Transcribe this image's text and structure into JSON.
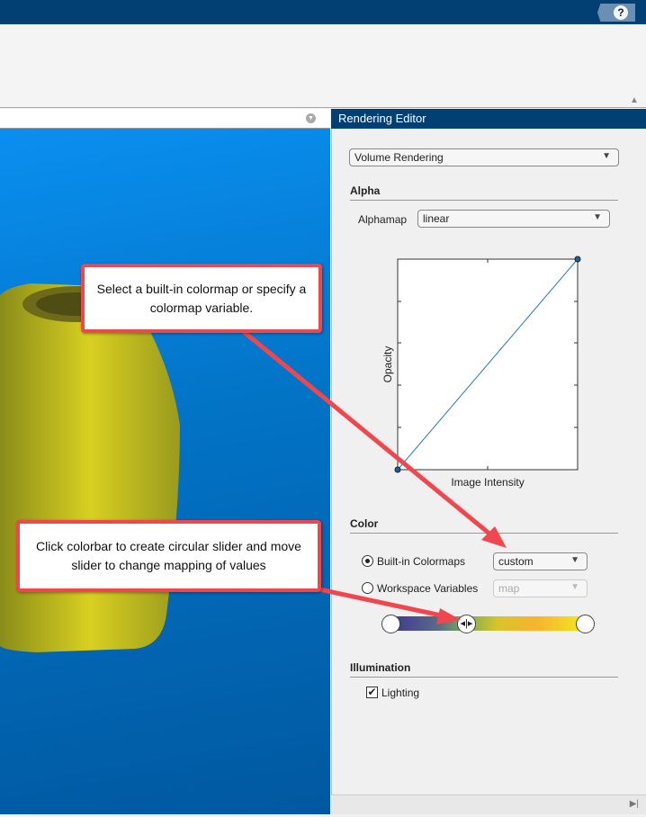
{
  "help_label": "?",
  "panel": {
    "title": "Rendering Editor",
    "render_mode": "Volume Rendering",
    "alpha": {
      "section": "Alpha",
      "alphamap_label": "Alphamap",
      "alphamap_value": "linear",
      "plot": {
        "xlabel": "Image Intensity",
        "ylabel": "Opacity",
        "line": [
          [
            0,
            0
          ],
          [
            1,
            1
          ]
        ]
      }
    },
    "color": {
      "section": "Color",
      "builtin_label": "Built-in Colormaps",
      "builtin_value": "custom",
      "builtin_selected": true,
      "workspace_label": "Workspace Variables",
      "workspace_value": "map",
      "colorbar_stops": [
        "#3c3595",
        "#7aa859",
        "#d6c52a",
        "#f7b431",
        "#f2ea1a"
      ],
      "slider_positions": [
        0,
        0.39,
        1
      ]
    },
    "illumination": {
      "section": "Illumination",
      "lighting_label": "Lighting",
      "lighting_checked": true
    }
  },
  "callouts": {
    "colormap": "Select a built-in colormap or specify a colormap variable.",
    "colorbar": "Click colorbar to create circular slider and move slider to change mapping of values"
  }
}
